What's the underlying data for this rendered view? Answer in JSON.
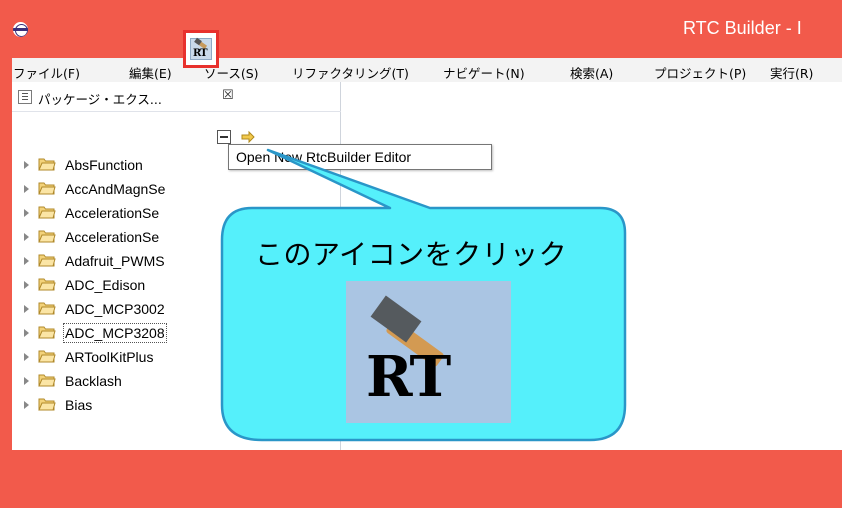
{
  "window": {
    "title": "RTC Builder - I",
    "logo_icon": "eclipse-icon",
    "frame_color": "#f25a4b"
  },
  "menu": {
    "items": [
      {
        "label": "ファイル(F)"
      },
      {
        "label": "編集(E)"
      },
      {
        "label": "ソース(S)"
      },
      {
        "label": "リファクタリング(T)"
      },
      {
        "label": "ナビゲート(N)"
      },
      {
        "label": "検索(A)"
      },
      {
        "label": "プロジェクト(P)"
      },
      {
        "label": "実行(R)"
      }
    ]
  },
  "toolbar": {
    "icons": [
      "new-icon",
      "save-icon",
      "save-all-icon",
      "print-icon",
      "rtc-builder-icon",
      "debug-icon",
      "run-icon",
      "external-tools-icon",
      "open-folder-icon",
      "pencil-icon",
      "next-annotation-icon",
      "prev-annotation-icon",
      "back-icon",
      "back-arrow-icon",
      "forward-arrow-icon"
    ],
    "highlight_color": "#e8312d"
  },
  "tooltip": {
    "text": "Open New RtcBuilder Editor"
  },
  "panel": {
    "title": "パッケージ・エクス...",
    "close_symbol": "☒"
  },
  "tree": {
    "items": [
      {
        "label": "AbsFunction"
      },
      {
        "label": "AccAndMagnSe"
      },
      {
        "label": "AccelerationSe"
      },
      {
        "label": "AccelerationSe"
      },
      {
        "label": "Adafruit_PWMS"
      },
      {
        "label": "ADC_Edison"
      },
      {
        "label": "ADC_MCP3002"
      },
      {
        "label": "ADC_MCP3208",
        "selected": true
      },
      {
        "label": "ARToolKitPlus"
      },
      {
        "label": "Backlash"
      },
      {
        "label": "Bias"
      }
    ]
  },
  "callout": {
    "text": "このアイコンをクリック",
    "fill": "#55f0fb",
    "stroke": "#2a96c8",
    "icon_text": "RT"
  }
}
